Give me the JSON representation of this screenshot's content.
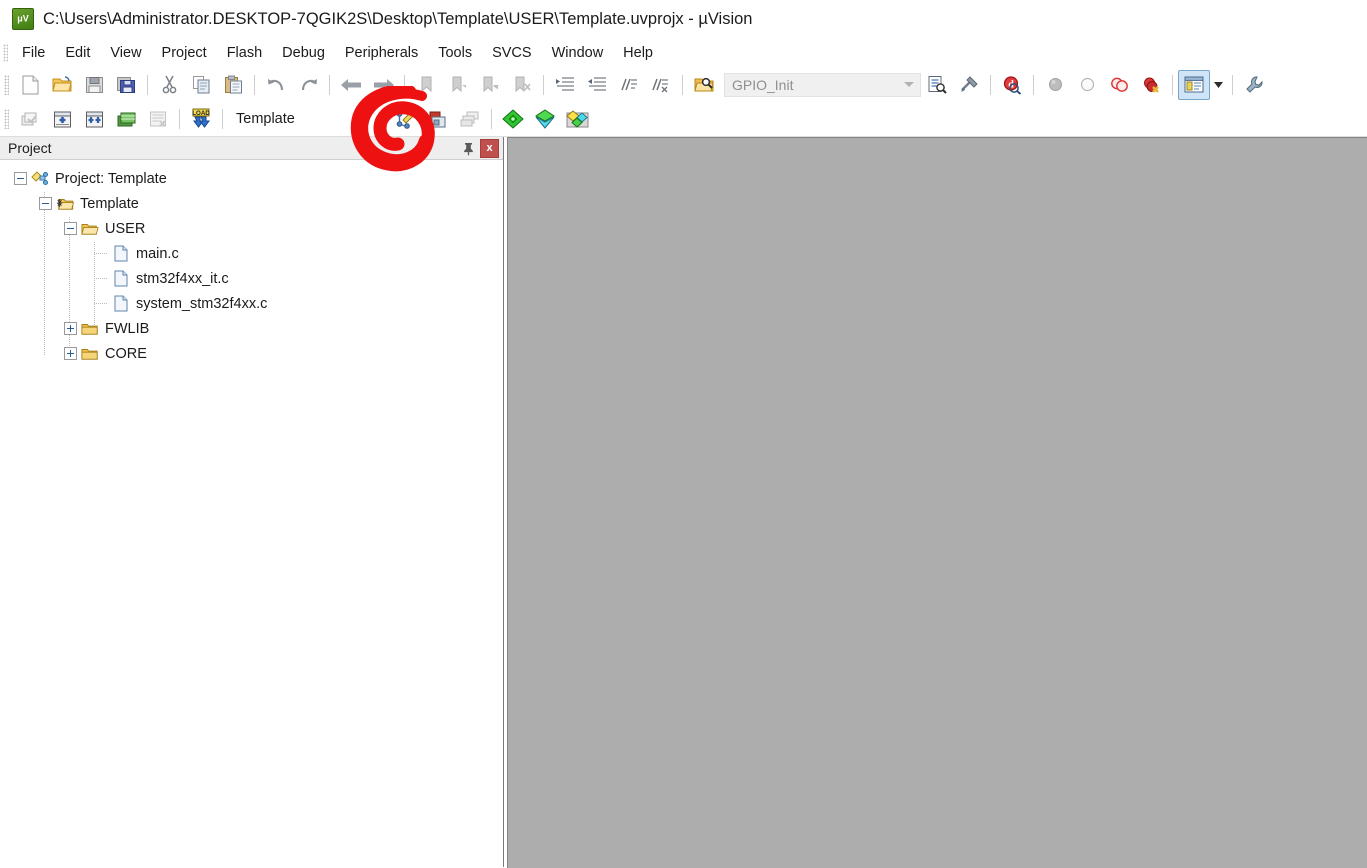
{
  "window": {
    "title": "C:\\Users\\Administrator.DESKTOP-7QGIK2S\\Desktop\\Template\\USER\\Template.uvprojx - µVision",
    "app_icon": "uvision-logo-icon",
    "background_color": "#adadad"
  },
  "menubar": {
    "items": [
      {
        "label": "File"
      },
      {
        "label": "Edit"
      },
      {
        "label": "View"
      },
      {
        "label": "Project"
      },
      {
        "label": "Flash"
      },
      {
        "label": "Debug"
      },
      {
        "label": "Peripherals"
      },
      {
        "label": "Tools"
      },
      {
        "label": "SVCS"
      },
      {
        "label": "Window"
      },
      {
        "label": "Help"
      }
    ]
  },
  "toolbar_main": {
    "buttons": [
      {
        "name": "new-file-icon",
        "tooltip": "New",
        "enabled": true
      },
      {
        "name": "open-file-icon",
        "tooltip": "Open",
        "enabled": true
      },
      {
        "name": "save-icon",
        "tooltip": "Save",
        "enabled": true
      },
      {
        "name": "save-all-icon",
        "tooltip": "Save All",
        "enabled": true
      },
      {
        "name": "cut-icon",
        "tooltip": "Cut",
        "enabled": true
      },
      {
        "name": "copy-icon",
        "tooltip": "Copy",
        "enabled": true
      },
      {
        "name": "paste-icon",
        "tooltip": "Paste",
        "enabled": true
      },
      {
        "name": "undo-icon",
        "tooltip": "Undo",
        "enabled": true
      },
      {
        "name": "redo-icon",
        "tooltip": "Redo",
        "enabled": true
      },
      {
        "name": "back-icon",
        "tooltip": "Navigate Backwards",
        "enabled": true
      },
      {
        "name": "forward-icon",
        "tooltip": "Navigate Forwards",
        "enabled": true
      },
      {
        "name": "bookmark-toggle-icon",
        "tooltip": "Insert/Remove Bookmark",
        "enabled": false
      },
      {
        "name": "bookmark-prev-icon",
        "tooltip": "Previous Bookmark",
        "enabled": false
      },
      {
        "name": "bookmark-next-icon",
        "tooltip": "Next Bookmark",
        "enabled": false
      },
      {
        "name": "bookmark-clear-icon",
        "tooltip": "Clear All Bookmarks",
        "enabled": false
      },
      {
        "name": "indent-right-icon",
        "tooltip": "Indent Selection",
        "enabled": true
      },
      {
        "name": "indent-left-icon",
        "tooltip": "Unindent Selection",
        "enabled": true
      },
      {
        "name": "comment-icon",
        "tooltip": "Comment Selection",
        "enabled": true
      },
      {
        "name": "uncomment-icon",
        "tooltip": "Uncomment Selection",
        "enabled": true
      },
      {
        "name": "find-in-files-icon",
        "tooltip": "Find in Files",
        "enabled": true
      }
    ],
    "combo": {
      "name": "function-navigate-combo",
      "value": "GPIO_Init",
      "placeholder": "GPIO_Init"
    },
    "right_buttons": [
      {
        "name": "browse-info-icon",
        "tooltip": "Browse Information",
        "enabled": true
      },
      {
        "name": "go-to-definition-icon",
        "tooltip": "Go To Definition",
        "enabled": true
      },
      {
        "name": "find-icon",
        "tooltip": "Find",
        "enabled": true
      },
      {
        "name": "breakpoint-insert-icon",
        "tooltip": "Insert/Remove Breakpoint",
        "enabled": false
      },
      {
        "name": "breakpoint-enable-icon",
        "tooltip": "Enable/Disable Breakpoint",
        "enabled": false
      },
      {
        "name": "breakpoint-disable-all-icon",
        "tooltip": "Disable All Breakpoints",
        "enabled": true
      },
      {
        "name": "breakpoint-kill-all-icon",
        "tooltip": "Kill All Breakpoints",
        "enabled": true
      },
      {
        "name": "window-layout-icon",
        "tooltip": "Manage Window Layouts",
        "enabled": true,
        "active": true
      },
      {
        "name": "configure-toolbars-icon",
        "tooltip": "Customize",
        "enabled": true
      }
    ]
  },
  "toolbar_build": {
    "buttons": [
      {
        "name": "translate-file-icon",
        "tooltip": "Translate Current File",
        "enabled": false
      },
      {
        "name": "build-target-icon",
        "tooltip": "Build",
        "enabled": true
      },
      {
        "name": "rebuild-all-icon",
        "tooltip": "Rebuild",
        "enabled": true
      },
      {
        "name": "batch-build-icon",
        "tooltip": "Batch Build",
        "enabled": true
      },
      {
        "name": "stop-build-icon",
        "tooltip": "Stop Build",
        "enabled": false
      },
      {
        "name": "download-icon",
        "tooltip": "Download",
        "enabled": true
      }
    ],
    "target_label": "Template",
    "right_buttons": [
      {
        "name": "configure-target-options-icon",
        "tooltip": "Options for Target",
        "enabled": true,
        "annotated": true
      },
      {
        "name": "manage-project-items-icon",
        "tooltip": "Manage Project Items",
        "enabled": true
      },
      {
        "name": "multi-project-icon",
        "tooltip": "Manage Multi-Project",
        "enabled": false
      },
      {
        "name": "pack-installer-icon",
        "tooltip": "Pack Installer",
        "enabled": true
      },
      {
        "name": "select-software-packs-icon",
        "tooltip": "Select Software Packs",
        "enabled": true
      },
      {
        "name": "manage-run-time-env-icon",
        "tooltip": "Manage Run-Time Environment",
        "enabled": true
      }
    ]
  },
  "project_panel": {
    "title": "Project",
    "pin_icon": "pin-icon",
    "close_icon": "close-icon",
    "close_label": "x",
    "tree": [
      {
        "label": "Project: Template",
        "depth": 0,
        "icon": "project-icon",
        "expander": "minus"
      },
      {
        "label": "Template",
        "depth": 1,
        "icon": "target-icon",
        "expander": "minus"
      },
      {
        "label": "USER",
        "depth": 2,
        "icon": "group-open-icon",
        "expander": "minus"
      },
      {
        "label": "main.c",
        "depth": 3,
        "icon": "c-file-icon",
        "expander": "none"
      },
      {
        "label": "stm32f4xx_it.c",
        "depth": 3,
        "icon": "c-file-icon",
        "expander": "none"
      },
      {
        "label": "system_stm32f4xx.c",
        "depth": 3,
        "icon": "c-file-icon",
        "expander": "none"
      },
      {
        "label": "FWLIB",
        "depth": 2,
        "icon": "group-icon",
        "expander": "plus"
      },
      {
        "label": "CORE",
        "depth": 2,
        "icon": "group-icon",
        "expander": "plus"
      }
    ]
  },
  "annotation": {
    "name": "red-circle-annotation",
    "color": "#ee1111",
    "describes": "configure-target-options-icon"
  }
}
